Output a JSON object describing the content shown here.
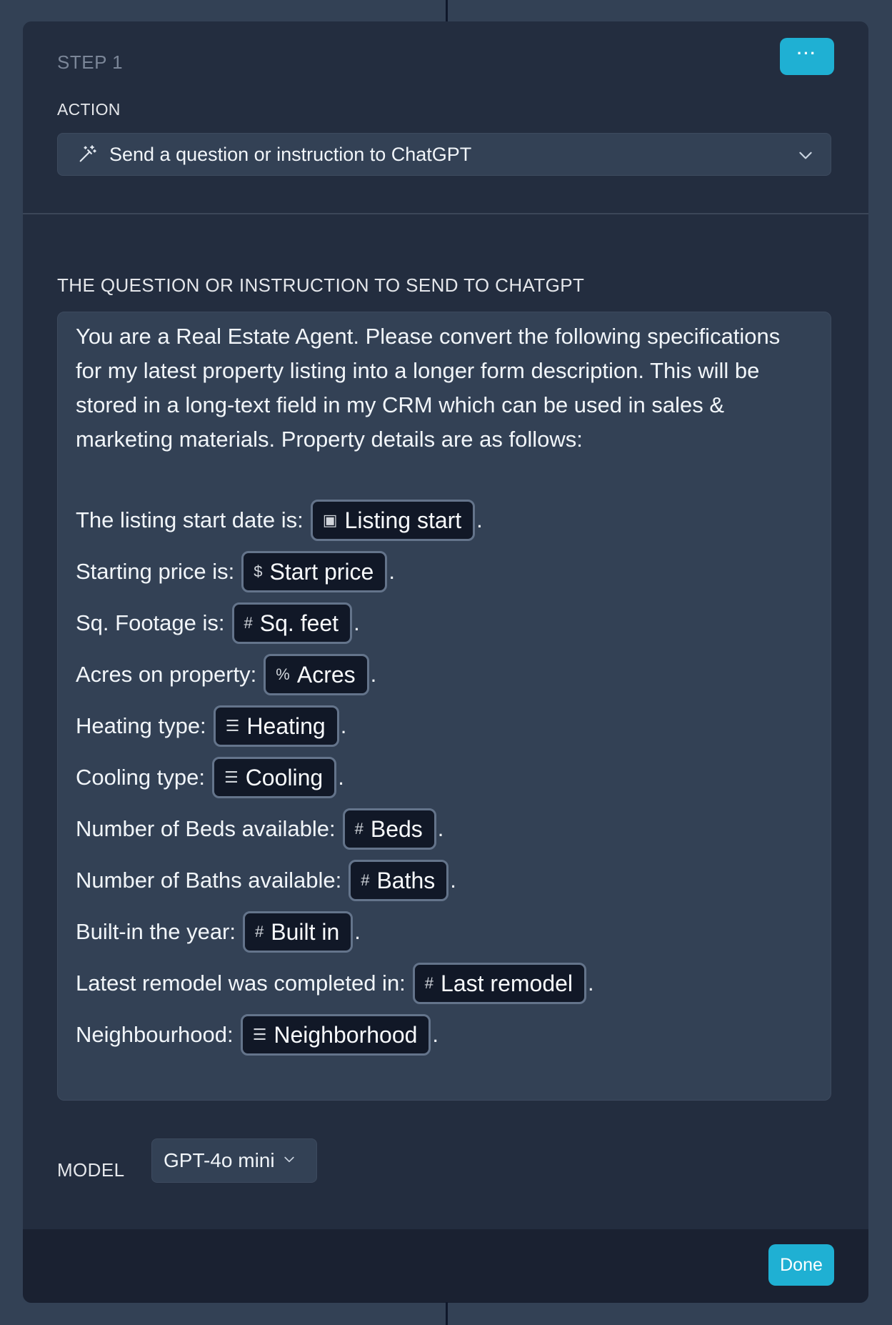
{
  "step": {
    "label": "STEP 1",
    "more_button_label": "···"
  },
  "action": {
    "label": "ACTION",
    "selected": "Send a question or instruction to ChatGPT",
    "icon": "magic-wand-icon"
  },
  "question": {
    "label": "THE QUESTION OR INSTRUCTION TO SEND TO CHATGPT",
    "intro": "You are a Real Estate Agent. Please convert the following specifications for my latest property listing into a longer form description. This will be stored in a long-text field in my CRM which can be used in sales & marketing materials. Property details are as follows:",
    "fields": [
      {
        "prefix": "The listing start date is:",
        "icon": "calendar-icon",
        "icon_glyph": "▣",
        "token": "Listing start",
        "suffix": "."
      },
      {
        "prefix": "Starting price is:",
        "icon": "dollar-icon",
        "icon_glyph": "$",
        "token": "Start price",
        "suffix": "."
      },
      {
        "prefix": "Sq. Footage is:",
        "icon": "hash-icon",
        "icon_glyph": "#",
        "token": "Sq. feet",
        "suffix": "."
      },
      {
        "prefix": "Acres on property:",
        "icon": "percent-icon",
        "icon_glyph": "%",
        "token": "Acres",
        "suffix": "."
      },
      {
        "prefix": "Heating type:",
        "icon": "list-icon",
        "icon_glyph": "☰",
        "token": "Heating",
        "suffix": "."
      },
      {
        "prefix": "Cooling type:",
        "icon": "list-icon",
        "icon_glyph": "☰",
        "token": "Cooling",
        "suffix": "."
      },
      {
        "prefix": "Number of Beds available:",
        "icon": "hash-icon",
        "icon_glyph": "#",
        "token": "Beds",
        "suffix": "."
      },
      {
        "prefix": "Number of Baths available:",
        "icon": "hash-icon",
        "icon_glyph": "#",
        "token": "Baths",
        "suffix": "."
      },
      {
        "prefix": "Built-in the year:",
        "icon": "hash-icon",
        "icon_glyph": "#",
        "token": "Built in",
        "suffix": "."
      },
      {
        "prefix": "Latest remodel was completed in:",
        "icon": "hash-icon",
        "icon_glyph": "#",
        "token": "Last remodel",
        "suffix": "."
      },
      {
        "prefix": "Neighbourhood:",
        "icon": "list-icon",
        "icon_glyph": "☰",
        "token": "Neighborhood",
        "suffix": "."
      }
    ]
  },
  "model": {
    "label": "MODEL",
    "selected": "GPT-4o mini"
  },
  "footer": {
    "done_label": "Done"
  },
  "colors": {
    "accent": "#1fb0d3",
    "card": "#232d3f",
    "background": "#334155",
    "pill_bg": "#111827"
  }
}
